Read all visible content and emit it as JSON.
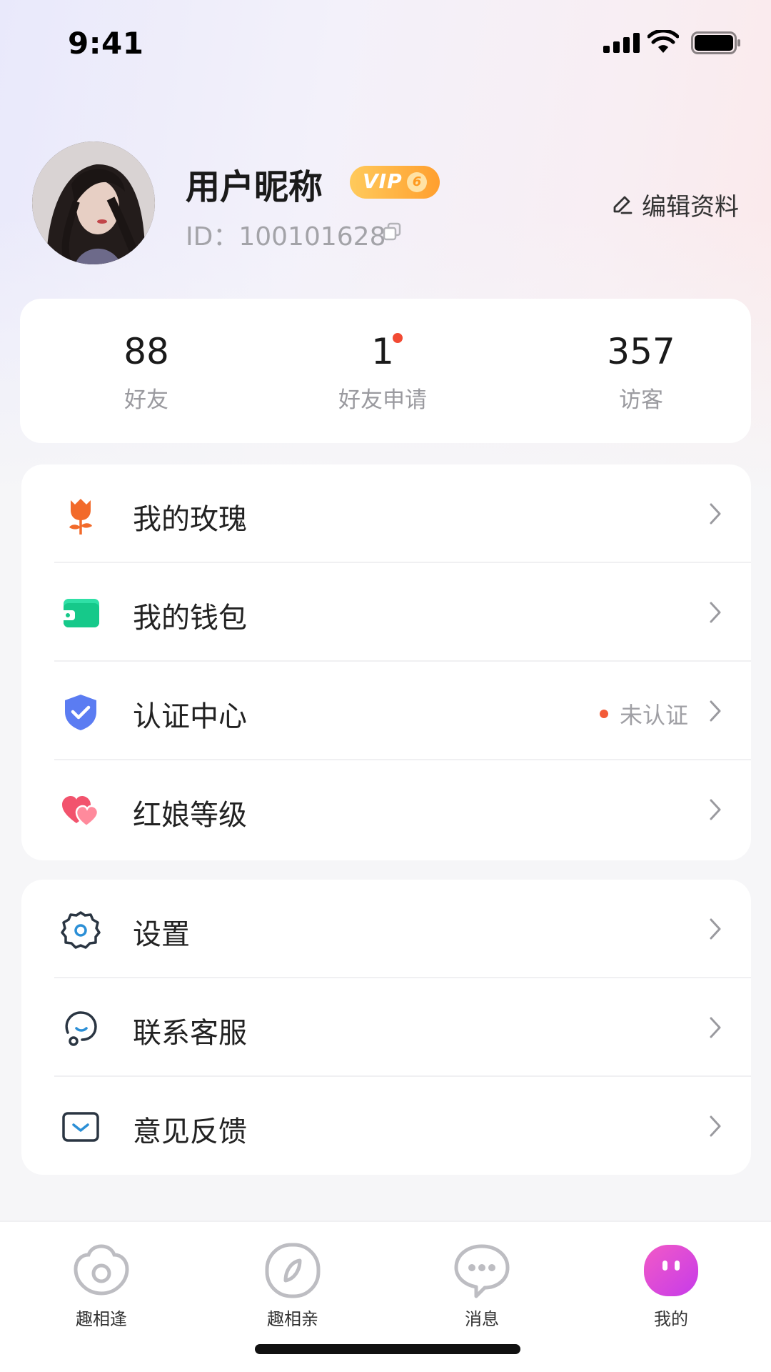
{
  "status_bar": {
    "time": "9:41"
  },
  "profile": {
    "nickname": "用户昵称",
    "vip_label": "VIP",
    "vip_level": "6",
    "id_text": "ID：100101628",
    "edit_label": "编辑资料"
  },
  "stats": [
    {
      "value": "88",
      "label": "好友"
    },
    {
      "value": "1",
      "label": "好友申请",
      "has_dot": true
    },
    {
      "value": "357",
      "label": "访客"
    }
  ],
  "menu_primary": [
    {
      "label": "我的玫瑰",
      "icon": "rose-icon"
    },
    {
      "label": "我的钱包",
      "icon": "wallet-icon"
    },
    {
      "label": "认证中心",
      "icon": "shield-check-icon",
      "status": "未认证"
    },
    {
      "label": "红娘等级",
      "icon": "hearts-icon"
    }
  ],
  "menu_secondary": [
    {
      "label": "设置",
      "icon": "gear-icon"
    },
    {
      "label": "联系客服",
      "icon": "headset-icon"
    },
    {
      "label": "意见反馈",
      "icon": "feedback-icon"
    }
  ],
  "tab_bar": [
    {
      "label": "趣相逢",
      "icon": "meet-icon"
    },
    {
      "label": "趣相亲",
      "icon": "compass-icon"
    },
    {
      "label": "消息",
      "icon": "message-icon"
    },
    {
      "label": "我的",
      "icon": "mine-icon",
      "active": true
    }
  ],
  "colors": {
    "accent_pink": "#e84bd8",
    "status_red": "#f35b38",
    "vip_orange": "#ff9f2e",
    "wallet_green": "#21d49a",
    "shield_blue": "#5b7cf2",
    "rose_orange": "#f26a2a",
    "heart_red": "#f2536d"
  }
}
